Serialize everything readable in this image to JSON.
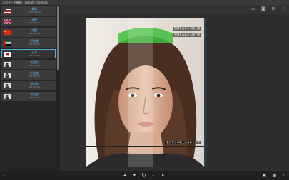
{
  "window": {
    "title": "ハロター手機能 - Beauty in Photo"
  },
  "toolbar": {
    "icons": [
      "gallery-icon",
      "camera-icon",
      "settings-icon",
      "more-icon"
    ]
  },
  "sidebar": {
    "items": [
      {
        "name": "美国",
        "sub": "8.5×11 mm",
        "flag": "us"
      },
      {
        "name": "英国",
        "sub": "35×45 mm",
        "flag": "uk"
      },
      {
        "name": "中国",
        "sub": "33×48 mm",
        "flag": "cn"
      },
      {
        "name": "阿联酋",
        "sub": "35×45 mm",
        "flag": "ae"
      },
      {
        "name": "日本",
        "sub": "35×45 mm",
        "flag": "jp",
        "active": true
      },
      {
        "name": "新西兰",
        "sub": "35×45 mm",
        "flag": "generic"
      },
      {
        "name": "新加坡",
        "sub": "35×45 mm",
        "flag": "generic"
      },
      {
        "name": "新加坡",
        "sub": "35×45 mm",
        "flag": "generic"
      },
      {
        "name": "新加坡",
        "sub": "35×45 mm",
        "flag": "generic"
      }
    ]
  },
  "photo": {
    "caption_top1": "頭頂を合わせる線上限",
    "caption_top2": "頭頂を合わせる線下限",
    "caption_bottom": "あごをこの線上に合わせます"
  },
  "bottom": {
    "left_text": "—",
    "icons": [
      "prev-icon",
      "down-icon",
      "rotate-icon",
      "up-icon",
      "next-icon",
      "crop-icon",
      "grid-icon",
      "check-icon"
    ]
  },
  "colors": {
    "accent": "#4fb3d9",
    "guide": "#3cbf3c"
  }
}
